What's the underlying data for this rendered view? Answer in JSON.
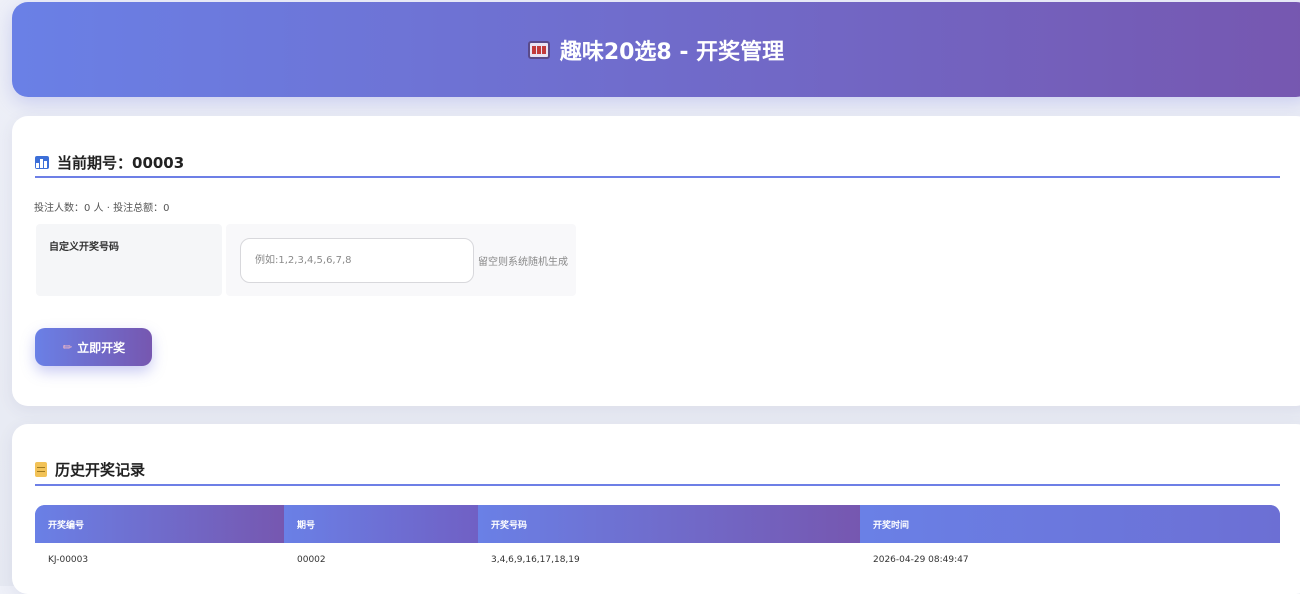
{
  "header": {
    "title": "趣味20选8 - 开奖管理",
    "icon": "slot-machine-icon"
  },
  "current": {
    "title": "当前期号：00003",
    "stats": "投注人数：0 人 · 投注总额：0",
    "form": {
      "label": "自定义开奖号码",
      "placeholder": "例如:1,2,3,4,5,6,7,8",
      "value": "",
      "hint": "留空则系统随机生成"
    },
    "draw_button": "立即开奖"
  },
  "history": {
    "title": "历史开奖记录",
    "columns": [
      "开奖编号",
      "期号",
      "开奖号码",
      "开奖时间"
    ],
    "rows": [
      [
        "KJ-00003",
        "00002",
        "3,4,6,9,16,17,18,19",
        "2026-04-29 08:49:47"
      ]
    ]
  },
  "colors": {
    "accent_start": "#6a80e6",
    "accent_end": "#7657b0"
  }
}
